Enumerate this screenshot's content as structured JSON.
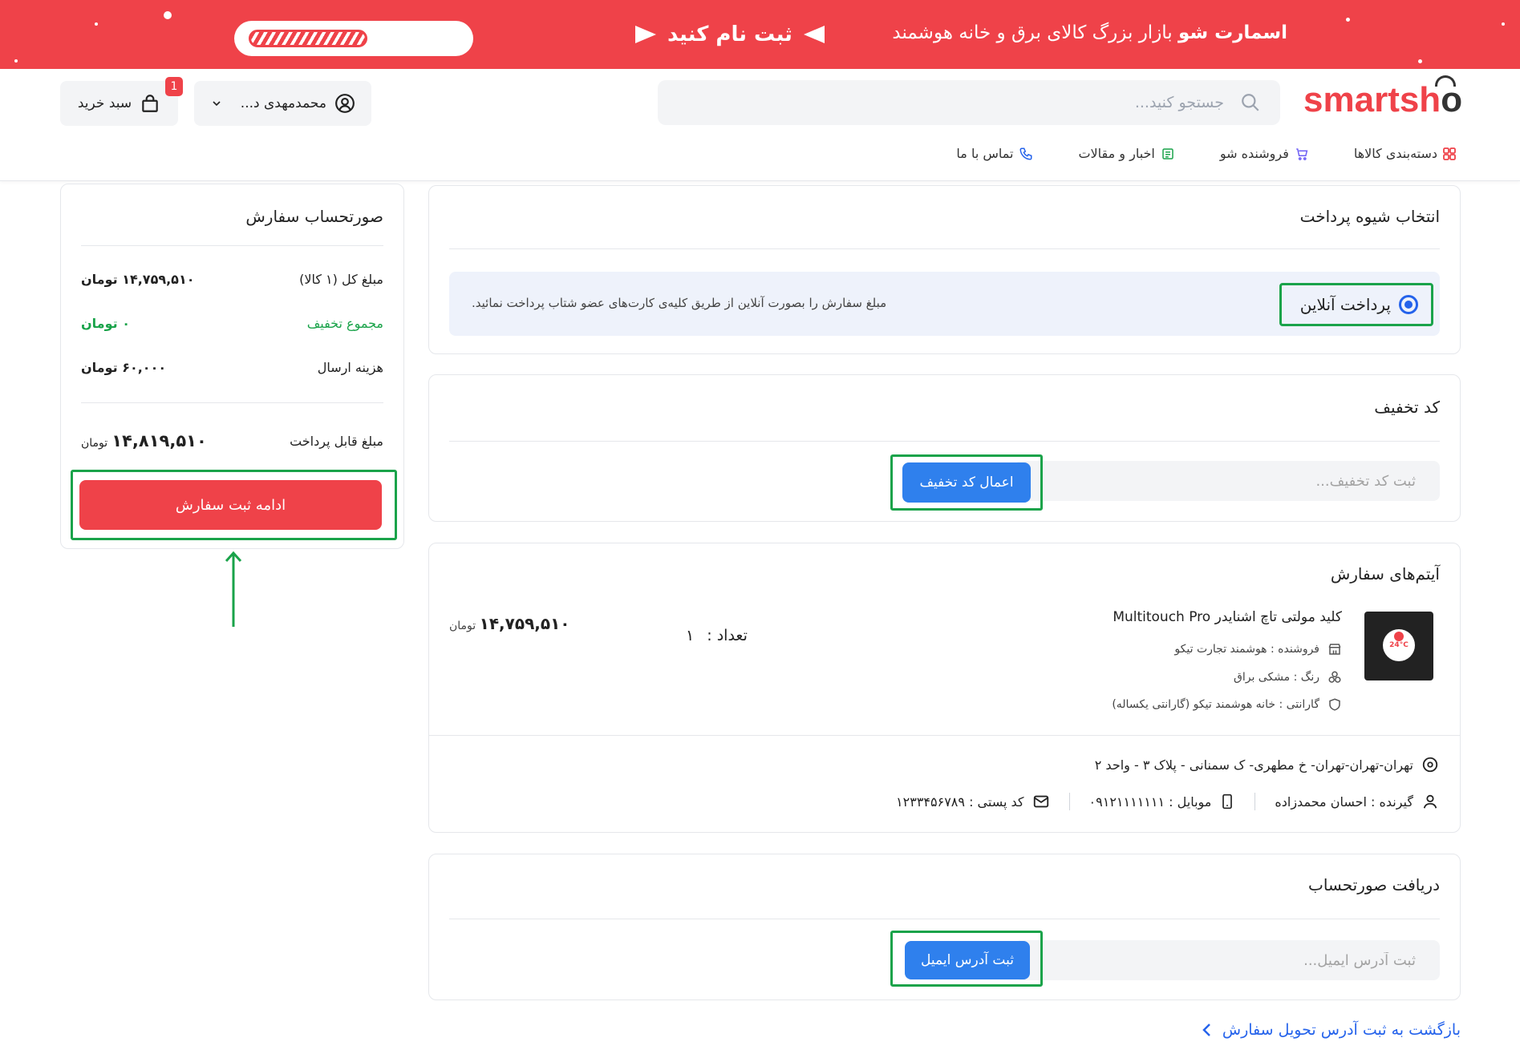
{
  "banner": {
    "brand": "اسمارت شو",
    "tagline": "بازار بزرگ کالای برق و خانه هوشمند",
    "cta": "ثبت نام کنید"
  },
  "header": {
    "logo_main": "smartsh",
    "logo_tail": "o",
    "search_placeholder": "جستجو کنید...",
    "user_name": "محمدمهدی د...",
    "cart_label": "سبد خرید",
    "cart_count": "1"
  },
  "nav": [
    {
      "label": "دسته‌بندی کالاها",
      "icon": "grid-icon"
    },
    {
      "label": "فروشنده شو",
      "icon": "cart-icon"
    },
    {
      "label": "اخبار و مقالات",
      "icon": "newspaper-icon"
    },
    {
      "label": "تماس با ما",
      "icon": "phone-icon"
    }
  ],
  "payment": {
    "title": "انتخاب شیوه پرداخت",
    "option_label": "پرداخت آنلاین",
    "option_desc": "مبلغ سفارش را بصورت آنلاین از طریق کلیه‌ی کارت‌های عضو شتاب پرداخت نمائید."
  },
  "discount": {
    "title": "کد تخفیف",
    "placeholder": "ثبت کد تخفیف...",
    "apply_label": "اعمال کد تخفیف"
  },
  "items": {
    "title": "آیتم‌های سفارش",
    "product_name": "کلید مولتی تاچ اشنایدر Multitouch Pro",
    "seller": "فروشنده : هوشمند تجارت تیکو",
    "color": "رنگ : مشکی براق",
    "warranty": "گارانتی : خانه هوشمند تیکو (گارانتی یکساله)",
    "qty_label": "تعداد :",
    "qty_value": "۱",
    "price": "۱۴,۷۵۹,۵۱۰",
    "currency": "تومان",
    "image_temp": "24°C",
    "address": "تهران-تهران-تهران- خ مطهری- ک سمنانی - پلاک ۳ - واحد ۲",
    "receiver": "گیرنده : احسان محمدزاده",
    "mobile": "موبایل : ۰۹۱۲۱۱۱۱۱۱۱",
    "postal": "کد پستی : ۱۲۳۳۴۵۶۷۸۹"
  },
  "invoice": {
    "title": "دریافت صورتحساب",
    "placeholder": "ثبت آدرس ایمیل...",
    "submit_label": "ثبت آدرس ایمیل"
  },
  "summary": {
    "title": "صورتحساب سفارش",
    "total_label": "مبلغ کل (۱ کالا)",
    "total_value": "۱۴,۷۵۹,۵۱۰ تومان",
    "discount_label": "مجموع تخفیف",
    "discount_value": "۰ تومان",
    "shipping_label": "هزینه ارسال",
    "shipping_value": "۶۰,۰۰۰ تومان",
    "payable_label": "مبلغ قابل پرداخت",
    "payable_value": "۱۴,۸۱۹,۵۱۰",
    "payable_currency": "تومان",
    "continue_label": "ادامه ثبت سفارش"
  },
  "back_link": "بازگشت به ثبت آدرس تحویل سفارش",
  "colors": {
    "brand_red": "#ef4249",
    "accent_blue": "#2f80ed",
    "highlight_green": "#1aa34a",
    "discount_green": "#1aa34a"
  }
}
